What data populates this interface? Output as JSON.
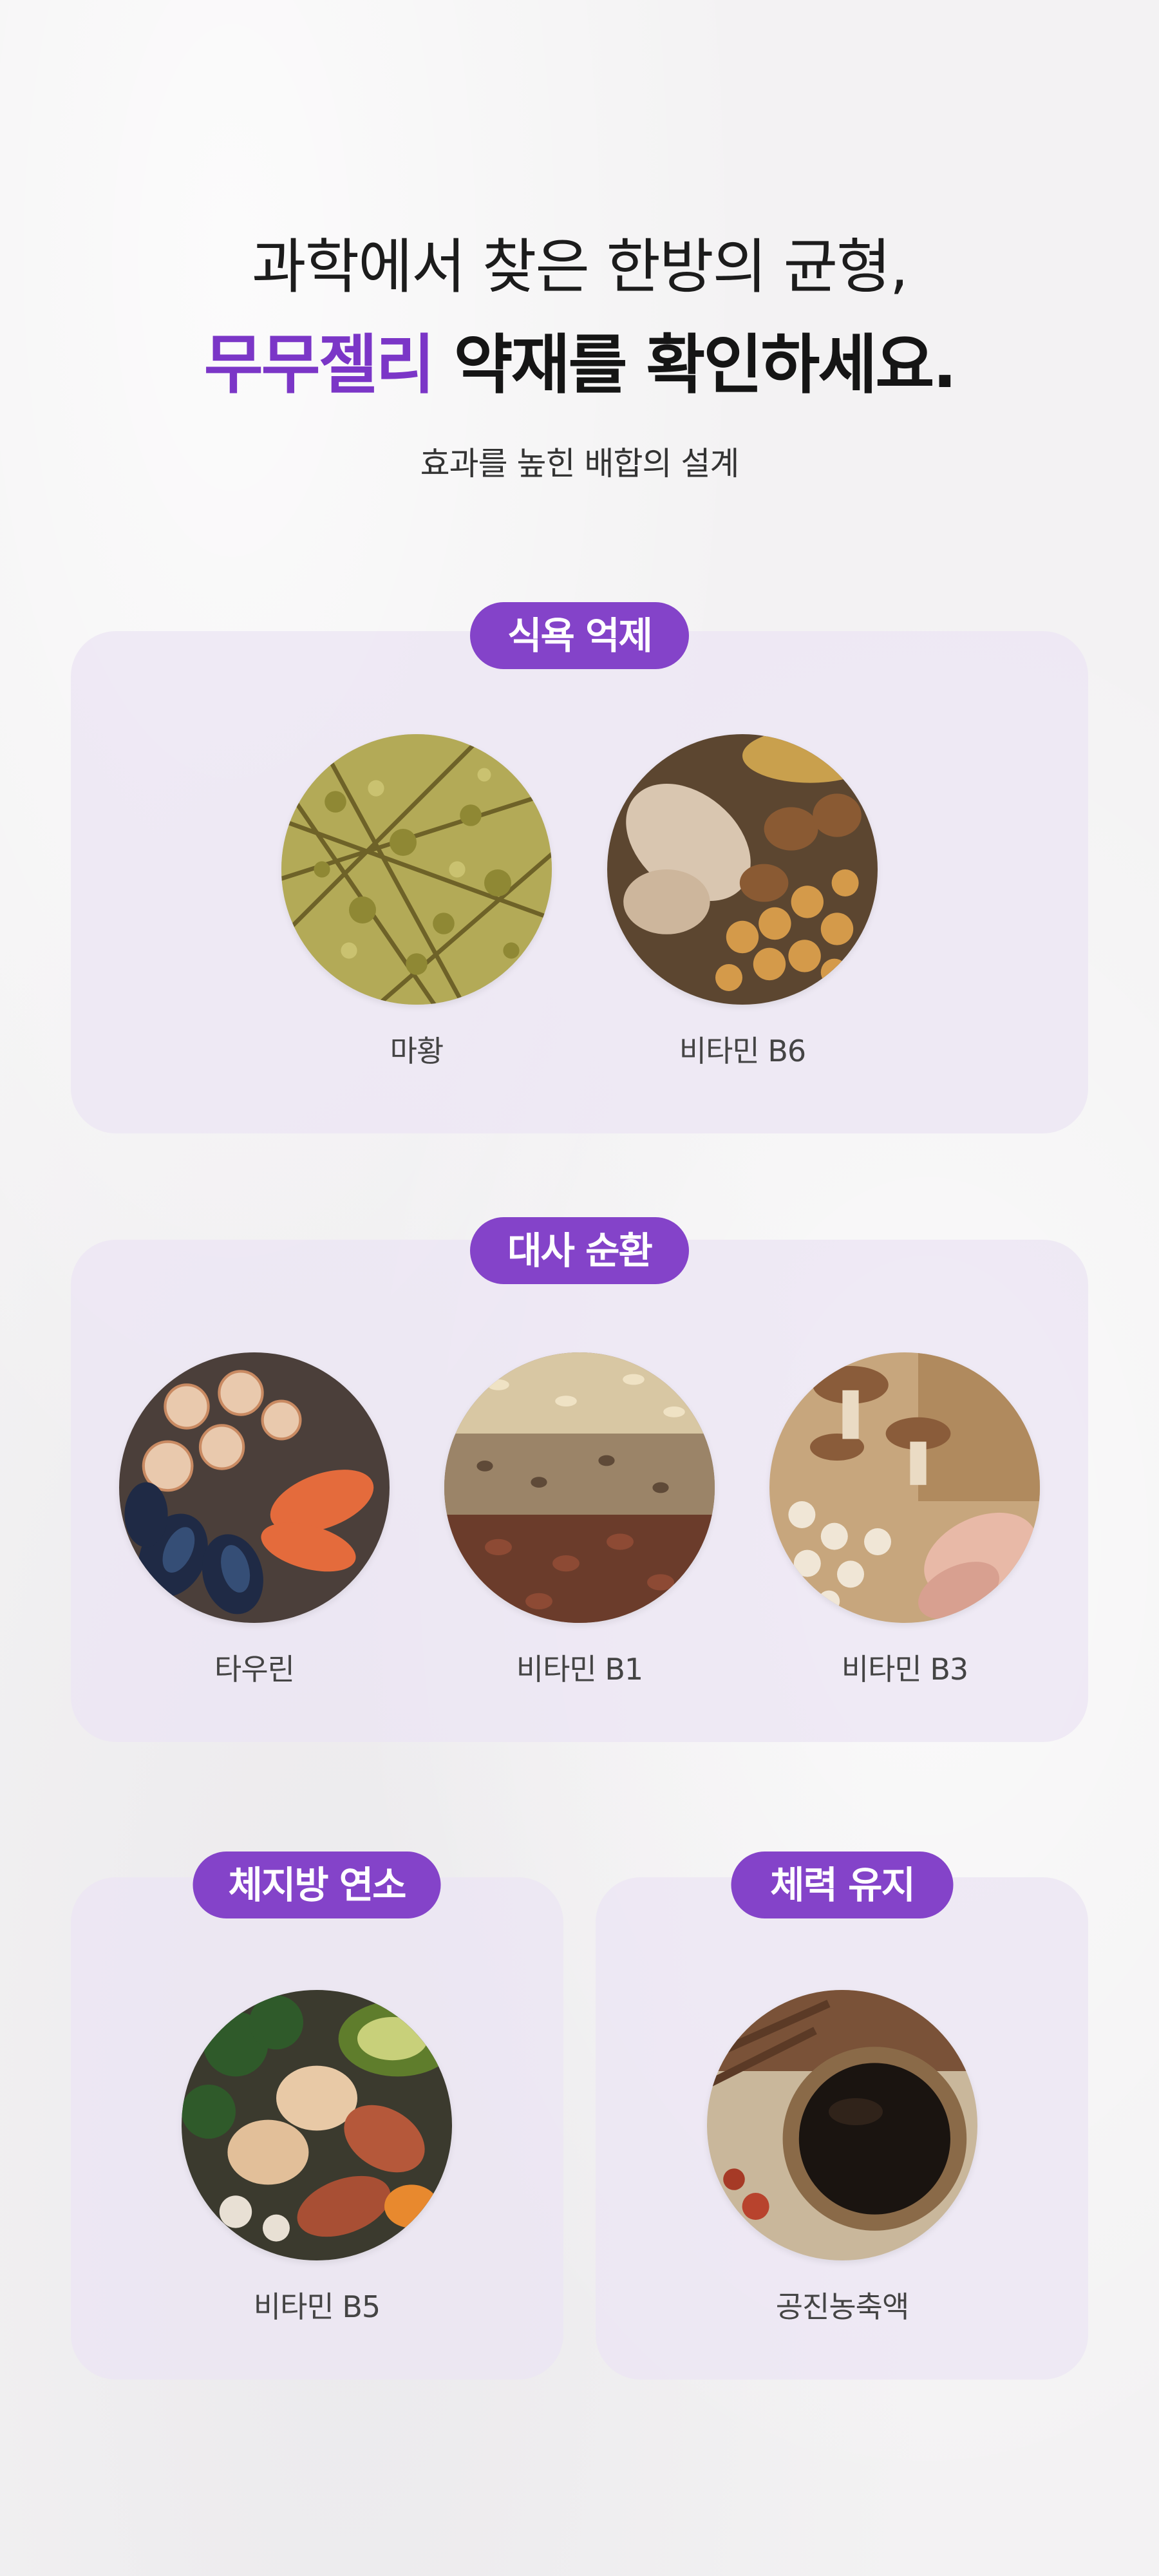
{
  "hero": {
    "line1": "과학에서 찾은 한방의 균형,",
    "line2_accent": "무무젤리",
    "line2_rest": " 약재를 확인하세요.",
    "subtitle": "효과를 높힌 배합의 설계"
  },
  "colors": {
    "accent": "#7b36c7",
    "pill": "#8443c9",
    "card": "#ece6f3"
  },
  "sections": [
    {
      "title": "식욕 억제",
      "items": [
        {
          "label": "마황",
          "icon": "dried-herb-photo"
        },
        {
          "label": "비타민 B6",
          "icon": "chicken-nuts-chickpeas-photo"
        }
      ]
    },
    {
      "title": "대사 순환",
      "items": [
        {
          "label": "타우린",
          "icon": "seafood-photo"
        },
        {
          "label": "비타민 B1",
          "icon": "grains-photo"
        },
        {
          "label": "비타민 B3",
          "icon": "mushrooms-seeds-photo"
        }
      ]
    },
    {
      "title": "체지방 연소",
      "items": [
        {
          "label": "비타민 B5",
          "icon": "eggs-vegetables-photo"
        }
      ]
    },
    {
      "title": "체력 유지",
      "items": [
        {
          "label": "공진농축액",
          "icon": "herbal-concentrate-photo"
        }
      ]
    }
  ]
}
